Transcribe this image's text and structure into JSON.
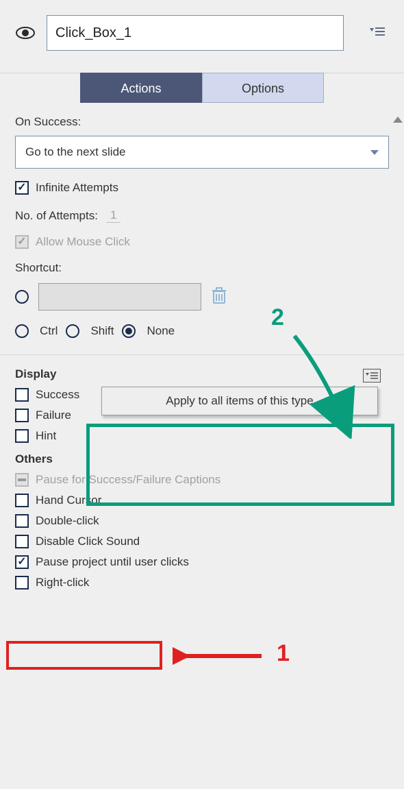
{
  "header": {
    "name_value": "Click_Box_1"
  },
  "tabs": {
    "actions": "Actions",
    "options": "Options"
  },
  "onSuccess": {
    "label": "On Success:",
    "value": "Go to the next slide"
  },
  "infiniteAttempts": {
    "label": "Infinite Attempts",
    "checked": true
  },
  "numAttempts": {
    "label": "No. of Attempts:",
    "value": "1"
  },
  "allowMouseClick": {
    "label": "Allow Mouse Click",
    "checked": true,
    "disabled": true
  },
  "shortcut": {
    "label": "Shortcut:",
    "modifiers": {
      "ctrl": "Ctrl",
      "shift": "Shift",
      "none": "None",
      "selected": "none"
    }
  },
  "display": {
    "heading": "Display",
    "items": [
      {
        "label": "Success",
        "checked": false
      },
      {
        "label": "Failure",
        "checked": false
      },
      {
        "label": "Hint",
        "checked": false
      }
    ]
  },
  "others": {
    "heading": "Others",
    "items": [
      {
        "label": "Pause for Success/Failure Captions",
        "state": "indeterminate",
        "disabled": true
      },
      {
        "label": "Hand Cursor",
        "checked": false
      },
      {
        "label": "Double-click",
        "checked": false
      },
      {
        "label": "Disable Click Sound",
        "checked": false
      },
      {
        "label": "Pause project until user clicks",
        "checked": true
      },
      {
        "label": "Right-click",
        "checked": false
      }
    ]
  },
  "popup": {
    "text": "Apply to all items of this type"
  },
  "callouts": {
    "one": "1",
    "two": "2"
  }
}
